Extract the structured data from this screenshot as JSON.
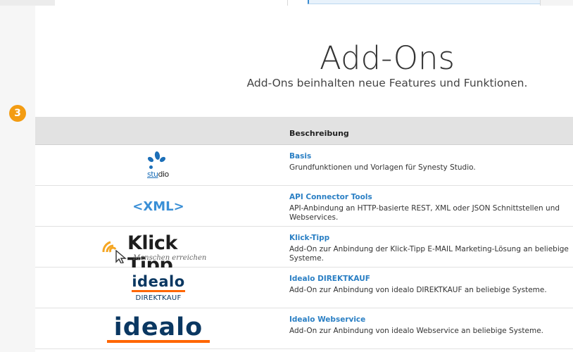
{
  "page": {
    "title": "Add-Ons",
    "subtitle": "Add-Ons beinhalten neue Features und Funktionen.",
    "step_badge": "3"
  },
  "table": {
    "header_description": "Beschreibung",
    "rows": [
      {
        "logo": "studio-logo",
        "logo_text_1": "stu",
        "logo_text_2": "dio",
        "name": "Basis",
        "description": "Grundfunktionen und Vorlagen für Synesty Studio."
      },
      {
        "logo": "xml-logo",
        "logo_text": "<XML>",
        "name": "API Connector Tools",
        "description": "API-Anbindung an HTTP-basierte REST, XML oder JSON Schnittstellen und Webservices."
      },
      {
        "logo": "klick-tipp-logo",
        "logo_text": "Klick Tipp",
        "logo_tagline": "Menschen erreichen",
        "name": "Klick-Tipp",
        "description": "Add-On zur Anbindung der Klick-Tipp E-MAIL Marketing-Lösung an beliebige Systeme."
      },
      {
        "logo": "idealo-direktkauf-logo",
        "logo_text": "idealo",
        "logo_subtext": "DIREKTKAUF",
        "name": "Idealo DIREKTKAUF",
        "description": "Add-On zur Anbindung von idealo DIREKTKAUF an beliebige Systeme."
      },
      {
        "logo": "idealo-logo",
        "logo_text": "idealo",
        "name": "Idealo Webservice",
        "description": "Add-On zur Anbindung von idealo Webservice an beliebige Systeme."
      }
    ]
  },
  "colors": {
    "link": "#2a7fc4",
    "badge": "#f39c12",
    "idealo_navy": "#0a3761",
    "idealo_orange": "#ff6600"
  }
}
